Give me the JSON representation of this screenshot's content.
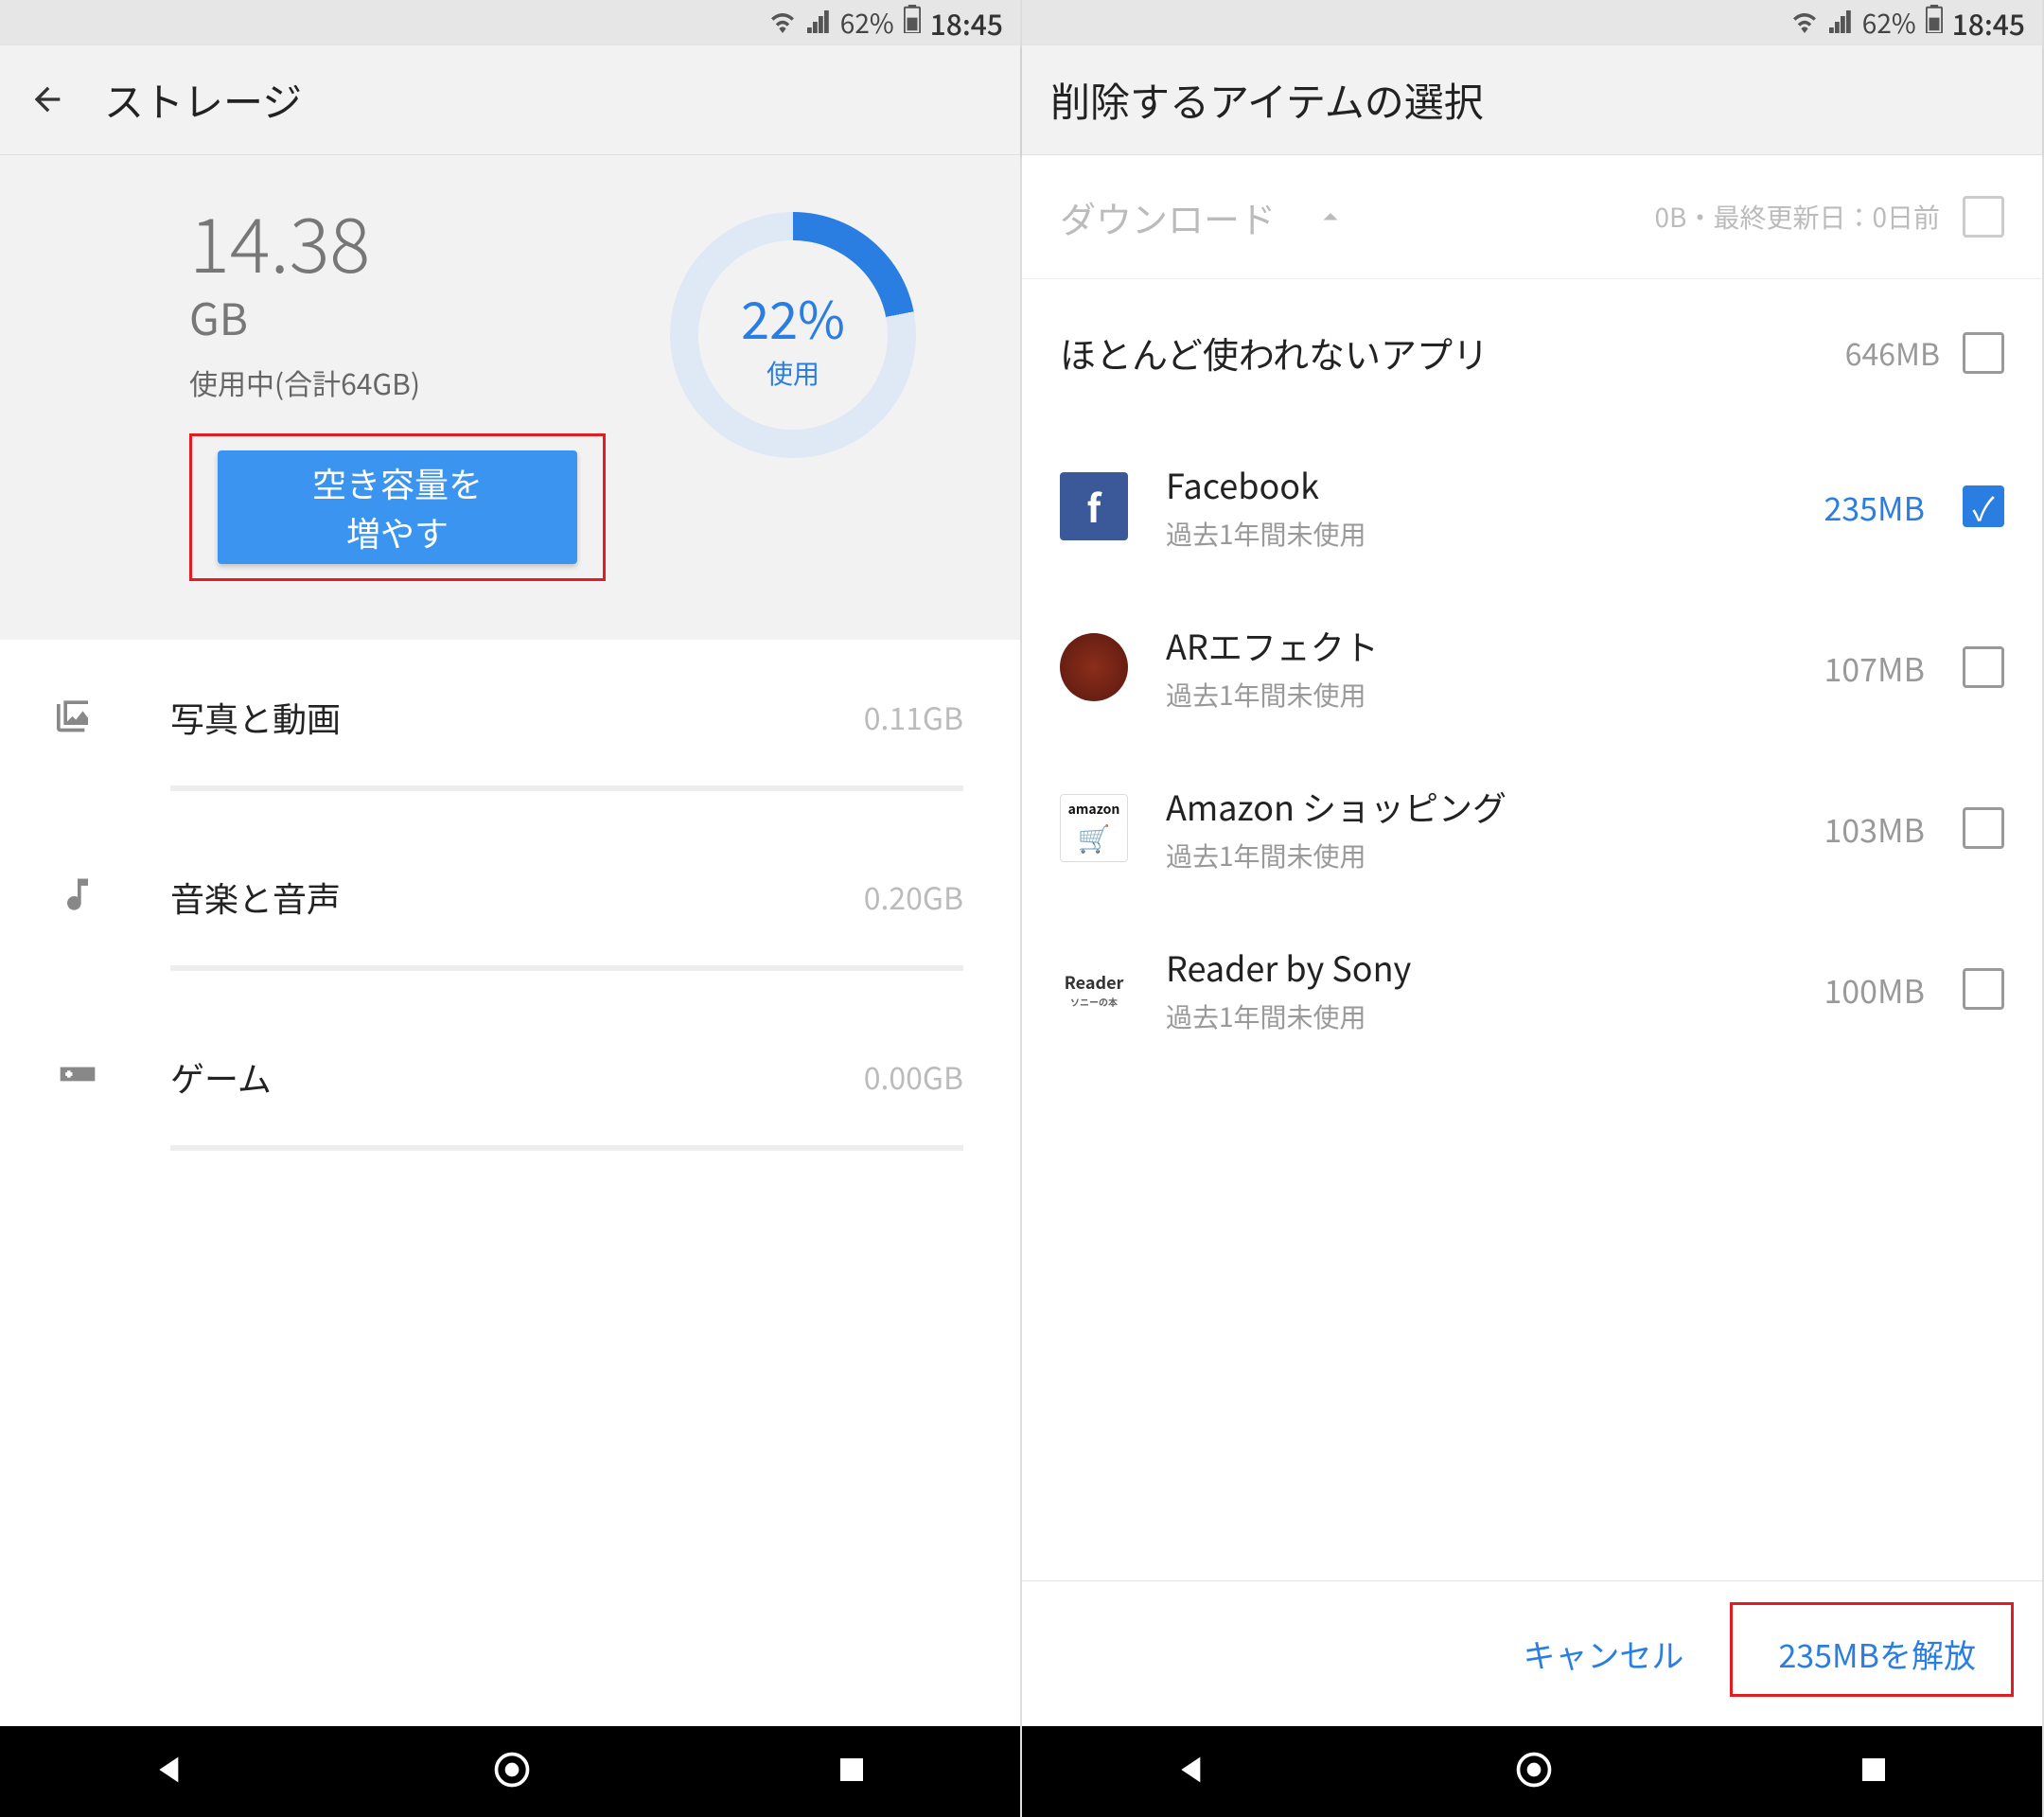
{
  "status": {
    "battery": "62%",
    "time": "18:45"
  },
  "left": {
    "title": "ストレージ",
    "used_value": "14.38",
    "used_unit": "GB",
    "used_sub": "使用中(合計64GB)",
    "free_button": "空き容量を\n増やす",
    "donut_pct": "22%",
    "donut_label": "使用",
    "categories": [
      {
        "name": "写真と動画",
        "size": "0.11GB"
      },
      {
        "name": "音楽と音声",
        "size": "0.20GB"
      },
      {
        "name": "ゲーム",
        "size": "0.00GB"
      }
    ]
  },
  "right": {
    "title": "削除するアイテムの選択",
    "downloads": {
      "label": "ダウンロード",
      "meta": "0B・最終更新日：0日前"
    },
    "unused_header": {
      "label": "ほとんど使われないアプリ",
      "size": "646MB"
    },
    "apps": [
      {
        "name": "Facebook",
        "sub": "過去1年間未使用",
        "size": "235MB",
        "selected": true,
        "icon": "fb"
      },
      {
        "name": "ARエフェクト",
        "sub": "過去1年間未使用",
        "size": "107MB",
        "selected": false,
        "icon": "ar"
      },
      {
        "name": "Amazon ショッピング",
        "sub": "過去1年間未使用",
        "size": "103MB",
        "selected": false,
        "icon": "amz"
      },
      {
        "name": "Reader by Sony",
        "sub": "過去1年間未使用",
        "size": "100MB",
        "selected": false,
        "icon": "reader"
      }
    ],
    "cancel": "キャンセル",
    "release": "235MBを解放"
  }
}
